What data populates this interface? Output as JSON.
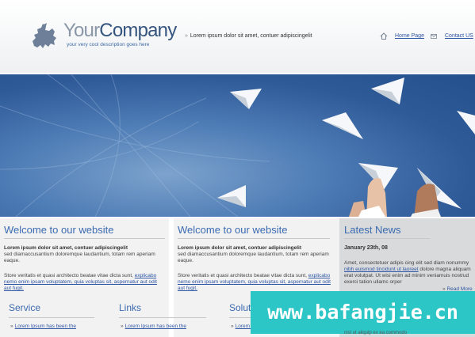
{
  "header": {
    "logo_your": "Your",
    "logo_company": "Company",
    "tagline": "your very cool description goes here",
    "text": "Lorem ipsum dolor sit amet, contuer adipiscingelit",
    "nav": {
      "home": "Home Page",
      "contact": "Contact US"
    }
  },
  "col1": {
    "title": "Welcome to our website",
    "bold": "Lorem ipsum dolor sit amet, contuer adipiscingelit",
    "p1": [
      "sed diamaccusantium doloremque laudantium, totam rem aperiam",
      "eaque."
    ],
    "p2_lead": "Store veritatis et quasi architecto beatae vitae dicta sunt,",
    "p2_link": [
      "explicabo",
      "nemo enim ipsam voluptatem, quia voluptas sit, aspernatur aut odit",
      "aut fugit."
    ]
  },
  "col2": {
    "title": "Welcome to our website",
    "bold": "Lorem ipsum dolor sit amet, contuer adipiscingelit",
    "p1": [
      "sed diamaccusantium doloremque laudantium, totam rem aperiam",
      "eaque."
    ],
    "p2_lead": "Store veritatis et quasi architecto beatae vitae dicta sunt,",
    "p2_link": [
      "explicabo",
      "nemo enim ipsam voluptatem, quia voluptas sit, aspernatur aut odit",
      "aut fugit."
    ]
  },
  "news": {
    "title": "Latest News",
    "date": "January 23th, 08",
    "body": [
      "Amet, consectetuer adipis cing elit sed diam nonummy",
      "nibh euismod tincidunt ut laoreet dolore magna aliquam",
      "erat volutpat. Ut wisi enim ad minim veniamuis nostrud",
      "exerci tation ullamc orper"
    ],
    "link_part": "nibh euismod tincidunt ut laoreet",
    "read_more": "Read More",
    "overlay_text": "nisl ut aliquip ex ea commodo"
  },
  "bottom": {
    "service": {
      "title": "Service",
      "item": "Lorem Ipsum has been the"
    },
    "links": {
      "title": "Links",
      "item": "Lorem Ipsum has been the"
    },
    "solutions": {
      "title": "Solutions",
      "item": "Lorem Ipsum has been the"
    }
  },
  "watermark": "www.bafangjie.cn",
  "colors": {
    "accent": "#3b6ab0",
    "link": "#2f56a4",
    "watermark": "#2cc6c6"
  }
}
